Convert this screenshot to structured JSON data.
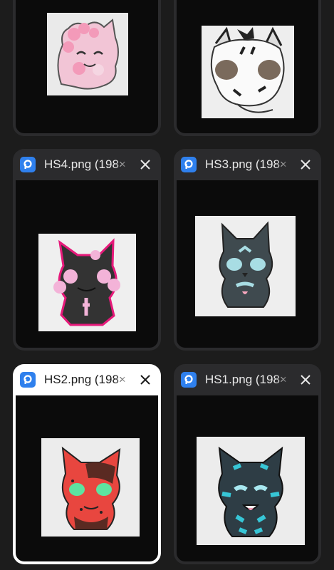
{
  "tabs": [
    {
      "id": "top-left",
      "title": "",
      "active": false
    },
    {
      "id": "top-right",
      "title": "",
      "active": false
    },
    {
      "id": "hs4",
      "title": "HS4.png (198×",
      "active": false,
      "image": "pink-black-cat-drawing"
    },
    {
      "id": "hs3",
      "title": "HS3.png (198×",
      "active": false,
      "image": "teal-cat-drawing"
    },
    {
      "id": "hs2",
      "title": "HS2.png (198×",
      "active": true,
      "image": "red-cat-drawing"
    },
    {
      "id": "hs1",
      "title": "HS1.png (198×",
      "active": false,
      "image": "blue-cat-drawing"
    }
  ],
  "colors": {
    "background": "#1c1c1c",
    "card": "#2b2b2d",
    "active_card": "#ffffff",
    "app_icon": "#2f80ed"
  },
  "icons": [
    "picsart-app-icon",
    "close-icon"
  ]
}
